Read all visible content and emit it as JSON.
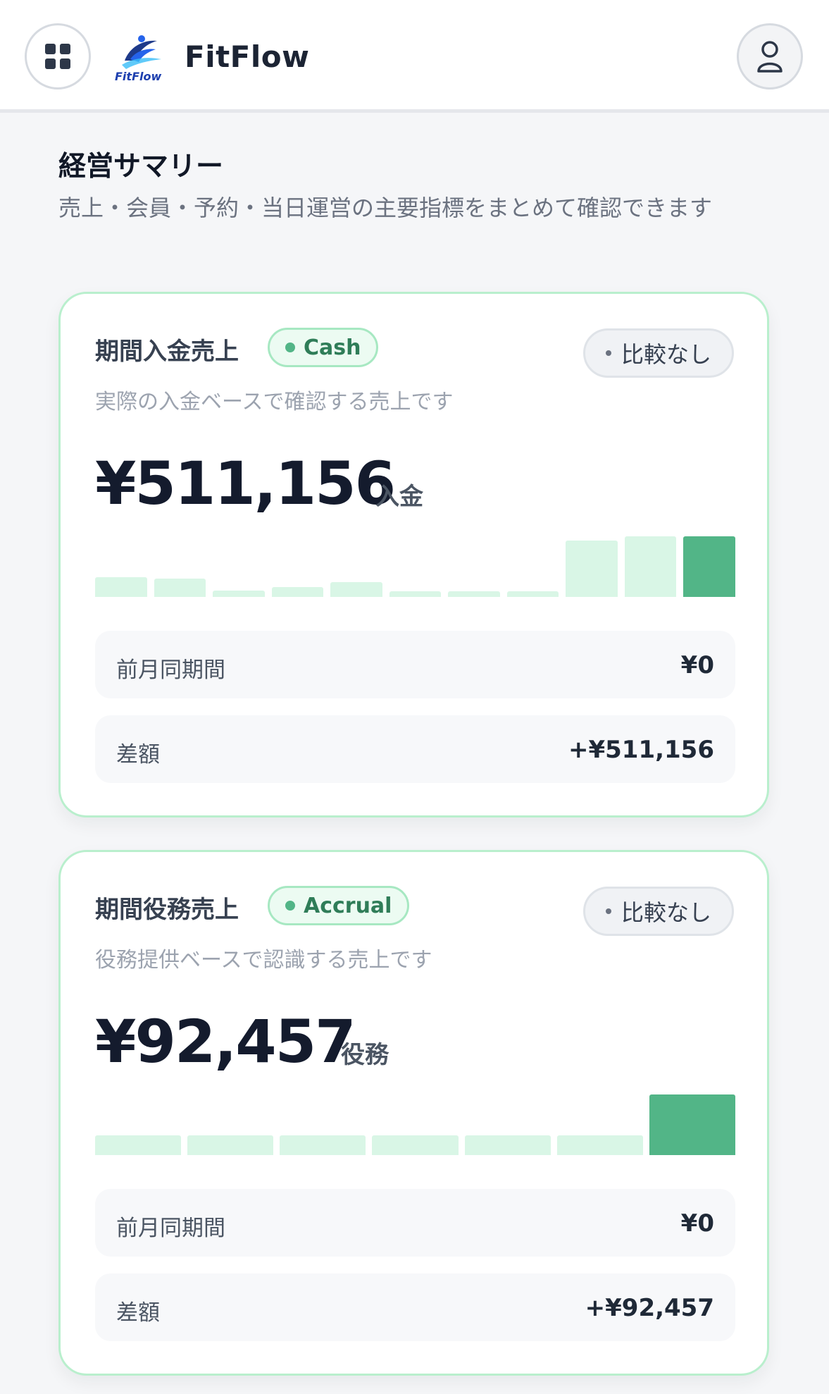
{
  "header": {
    "brand": "FitFlow",
    "logo_text": "FitFlow",
    "menu_icon": "grid-icon",
    "user_icon": "user-icon"
  },
  "page": {
    "title": "経営サマリー",
    "subtitle": "売上・会員・予約・当日運営の主要指標をまとめて確認できます"
  },
  "colors": {
    "accent": "#52b587",
    "bar_light": "#d9f6e6",
    "card_border": "#b9efcd"
  },
  "cards": [
    {
      "title": "期間入金売上",
      "tag": "Cash",
      "compare": "比較なし",
      "description": "実際の入金ベースで確認する売上です",
      "amount": "¥511,156",
      "unit": "入金",
      "bars": [
        0.33,
        0.3,
        0.1,
        0.16,
        0.25,
        0.09,
        0.09,
        0.09,
        0.93,
        1.0,
        1.0
      ],
      "rows": [
        {
          "label": "前月同期間",
          "value": "¥0"
        },
        {
          "label": "差額",
          "value": "+¥511,156"
        }
      ]
    },
    {
      "title": "期間役務売上",
      "tag": "Accrual",
      "compare": "比較なし",
      "description": "役務提供ベースで認識する売上です",
      "amount": "¥92,457",
      "unit": "役務",
      "bars": [
        0.33,
        0.33,
        0.33,
        0.33,
        0.33,
        0.33,
        1.0
      ],
      "rows": [
        {
          "label": "前月同期間",
          "value": "¥0"
        },
        {
          "label": "差額",
          "value": "+¥92,457"
        }
      ]
    }
  ]
}
